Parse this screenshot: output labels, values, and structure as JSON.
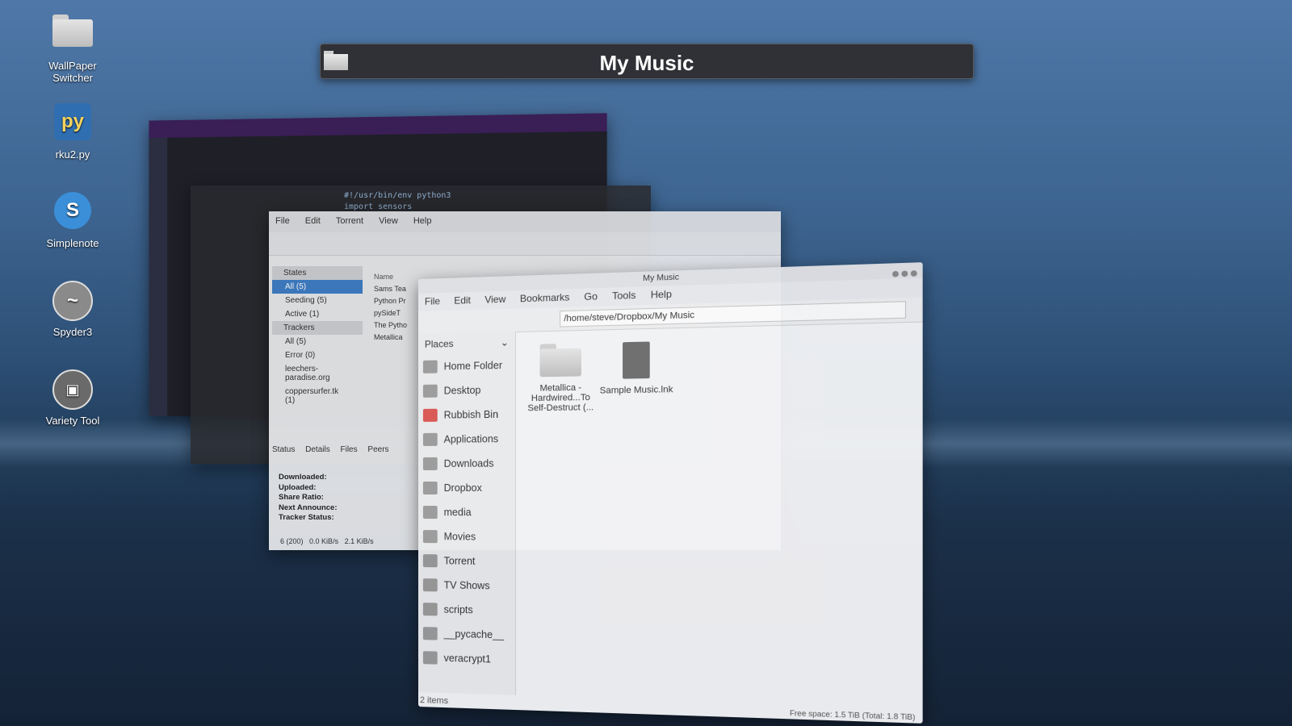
{
  "desktop_icons": [
    {
      "label": "WallPaper Switcher",
      "icon": "folder-icon"
    },
    {
      "label": "rku2.py",
      "icon": "python-icon"
    },
    {
      "label": "Simplenote",
      "icon": "simplenote-icon"
    },
    {
      "label": "Spyder3",
      "icon": "spyder-icon"
    },
    {
      "label": "Variety Tool",
      "icon": "variety-icon"
    }
  ],
  "switcher": {
    "title": "My Music"
  },
  "editor": {
    "line1": "#!/usr/bin/env python3",
    "line2": "import sensors"
  },
  "torrent": {
    "menu": [
      "File",
      "Edit",
      "Torrent",
      "View",
      "Help"
    ],
    "states_header": "States",
    "states": [
      "All (5)",
      "Seeding (5)",
      "Active (1)"
    ],
    "trackers_header": "Trackers",
    "trackers": [
      "All (5)",
      "Error (0)",
      "leechers-paradise.org",
      "coppersurfer.tk (1)"
    ],
    "name_header": "Name",
    "files": [
      "Sams Tea",
      "Python Pr",
      "pySideT",
      "The Pytho",
      "Metallica"
    ],
    "tabs": [
      "Status",
      "Details",
      "Files",
      "Peers"
    ],
    "info": [
      "Downloaded:",
      "Uploaded:",
      "Share Ratio:",
      "Next Announce:",
      "Tracker Status:"
    ],
    "statusbar": [
      "6 (200)",
      "0.0 KiB/s",
      "2.1 KiB/s"
    ]
  },
  "filemanager": {
    "title": "My Music",
    "menu": [
      "File",
      "Edit",
      "View",
      "Bookmarks",
      "Go",
      "Tools",
      "Help"
    ],
    "path": "/home/steve/Dropbox/My Music",
    "places_label": "Places",
    "places": [
      "Home Folder",
      "Desktop",
      "Rubbish Bin",
      "Applications",
      "Downloads",
      "Dropbox",
      "media",
      "Movies",
      "Torrent",
      "TV Shows",
      "scripts",
      "__pycache__",
      "veracrypt1"
    ],
    "files": [
      {
        "name": "Metallica - Hardwired...To Self-Destruct (...",
        "icon": "folder-icon"
      },
      {
        "name": "Sample Music.lnk",
        "icon": "link-file-icon"
      }
    ],
    "status": "2 items",
    "free_space": "Free space: 1.5 TiB (Total: 1.8 TiB)"
  }
}
